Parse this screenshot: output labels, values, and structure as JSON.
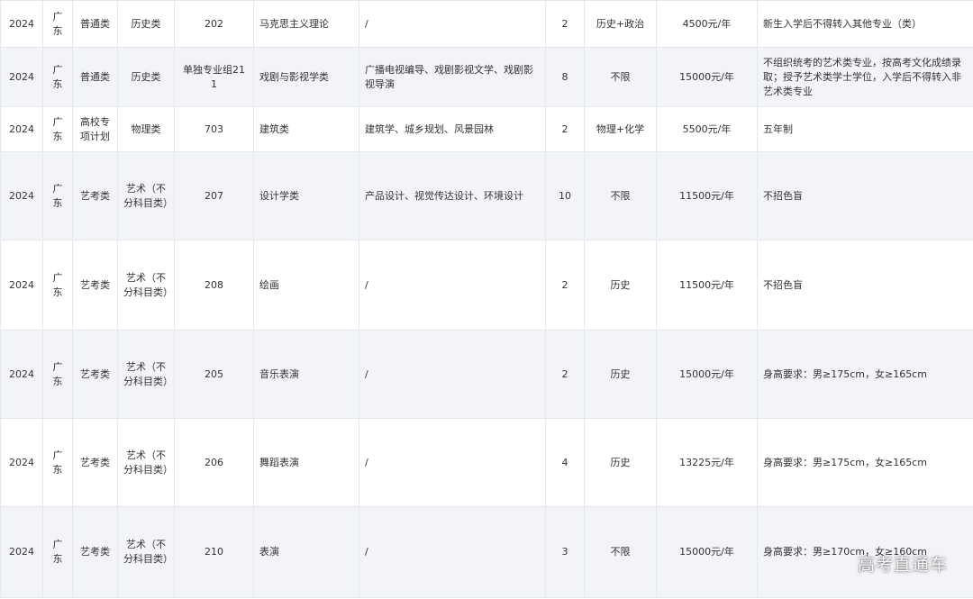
{
  "table": {
    "rows": [
      {
        "year": "2024",
        "province": "广东",
        "category": "普通类",
        "subject": "历史类",
        "group": "202",
        "major": "马克思主义理论",
        "directions": "/",
        "plan": "2",
        "requirement": "历史+政治",
        "tuition": "4500元/年",
        "remarks": "新生入学后不得转入其他专业（类）"
      },
      {
        "year": "2024",
        "province": "广东",
        "category": "普通类",
        "subject": "历史类",
        "group": "单独专业组211",
        "major": "戏剧与影视学类",
        "directions": "广播电视编导、戏剧影视文学、戏剧影视导演",
        "plan": "8",
        "requirement": "不限",
        "tuition": "15000元/年",
        "remarks": "不组织统考的艺术类专业，按高考文化成绩录取；授予艺术类学士学位，入学后不得转入非艺术类专业"
      },
      {
        "year": "2024",
        "province": "广东",
        "category": "高校专项计划",
        "subject": "物理类",
        "group": "703",
        "major": "建筑类",
        "directions": "建筑学、城乡规划、风景园林",
        "plan": "2",
        "requirement": "物理+化学",
        "tuition": "5500元/年",
        "remarks": "五年制"
      },
      {
        "year": "2024",
        "province": "广东",
        "category": "艺考类",
        "subject": "艺术（不分科目类）",
        "group": "207",
        "major": "设计学类",
        "directions": "产品设计、视觉传达设计、环境设计",
        "plan": "10",
        "requirement": "不限",
        "tuition": "11500元/年",
        "remarks": "不招色盲"
      },
      {
        "year": "2024",
        "province": "广东",
        "category": "艺考类",
        "subject": "艺术（不分科目类）",
        "group": "208",
        "major": "绘画",
        "directions": "/",
        "plan": "2",
        "requirement": "历史",
        "tuition": "11500元/年",
        "remarks": "不招色盲"
      },
      {
        "year": "2024",
        "province": "广东",
        "category": "艺考类",
        "subject": "艺术（不分科目类）",
        "group": "205",
        "major": "音乐表演",
        "directions": "/",
        "plan": "2",
        "requirement": "历史",
        "tuition": "15000元/年",
        "remarks": "身高要求：男≥175cm，女≥165cm"
      },
      {
        "year": "2024",
        "province": "广东",
        "category": "艺考类",
        "subject": "艺术（不分科目类）",
        "group": "206",
        "major": "舞蹈表演",
        "directions": "/",
        "plan": "4",
        "requirement": "历史",
        "tuition": "13225元/年",
        "remarks": "身高要求：男≥175cm，女≥165cm"
      },
      {
        "year": "2024",
        "province": "广东",
        "category": "艺考类",
        "subject": "艺术（不分科目类）",
        "group": "210",
        "major": "表演",
        "directions": "/",
        "plan": "3",
        "requirement": "不限",
        "tuition": "15000元/年",
        "remarks": "身高要求：男≥170cm，女≥160cm"
      }
    ]
  },
  "watermark": "高考直通车"
}
